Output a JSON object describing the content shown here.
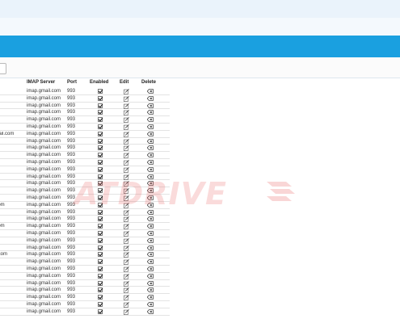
{
  "columns": {
    "imap": "IMAP Server",
    "port": "Port",
    "enabled": "Enabled",
    "edit": "Edit",
    "delete": "Delete"
  },
  "rows": [
    {
      "email": "",
      "imap": "imap.gmail.com",
      "port": "993"
    },
    {
      "email": "",
      "imap": "imap.gmail.com",
      "port": "993"
    },
    {
      "email": "n",
      "imap": "imap.gmail.com",
      "port": "993"
    },
    {
      "email": "",
      "imap": "imap.gmail.com",
      "port": "993"
    },
    {
      "email": "",
      "imap": "imap.gmail.com",
      "port": "993"
    },
    {
      "email": "",
      "imap": "imap.gmail.com",
      "port": "993"
    },
    {
      "email": "gmail.com",
      "imap": "imap.gmail.com",
      "port": "993"
    },
    {
      "email": "n",
      "imap": "imap.gmail.com",
      "port": "993"
    },
    {
      "email": "",
      "imap": "imap.gmail.com",
      "port": "993"
    },
    {
      "email": "",
      "imap": "imap.gmail.com",
      "port": "993"
    },
    {
      "email": "",
      "imap": "imap.gmail.com",
      "port": "993"
    },
    {
      "email": "",
      "imap": "imap.gmail.com",
      "port": "993"
    },
    {
      "email": "",
      "imap": "imap.gmail.com",
      "port": "993"
    },
    {
      "email": "",
      "imap": "imap.gmail.com",
      "port": "993"
    },
    {
      "email": "",
      "imap": "imap.gmail.com",
      "port": "993"
    },
    {
      "email": "",
      "imap": "imap.gmail.com",
      "port": "993"
    },
    {
      "email": "il.com",
      "imap": "imap.gmail.com",
      "port": "993"
    },
    {
      "email": "",
      "imap": "imap.gmail.com",
      "port": "993"
    },
    {
      "email": "",
      "imap": "imap.gmail.com",
      "port": "993"
    },
    {
      "email": "il.com",
      "imap": "imap.gmail.com",
      "port": "993"
    },
    {
      "email": "",
      "imap": "imap.gmail.com",
      "port": "993"
    },
    {
      "email": "",
      "imap": "imap.gmail.com",
      "port": "993"
    },
    {
      "email": "",
      "imap": "imap.gmail.com",
      "port": "993"
    },
    {
      "email": "ail.com",
      "imap": "imap.gmail.com",
      "port": "993"
    },
    {
      "email": "",
      "imap": "imap.gmail.com",
      "port": "993"
    },
    {
      "email": "",
      "imap": "imap.gmail.com",
      "port": "993"
    },
    {
      "email": "",
      "imap": "imap.gmail.com",
      "port": "993"
    },
    {
      "email": "",
      "imap": "imap.gmail.com",
      "port": "993"
    },
    {
      "email": "",
      "imap": "imap.gmail.com",
      "port": "993"
    },
    {
      "email": "",
      "imap": "imap.gmail.com",
      "port": "993"
    },
    {
      "email": "",
      "imap": "imap.gmail.com",
      "port": "993"
    },
    {
      "email": "",
      "imap": "imap.gmail.com",
      "port": "993"
    }
  ],
  "watermark": "ATDRIVE",
  "colors": {
    "header_bar": "#1aa0e0",
    "top_bar": "#eaf3fb",
    "watermark": "#e85a5a"
  }
}
